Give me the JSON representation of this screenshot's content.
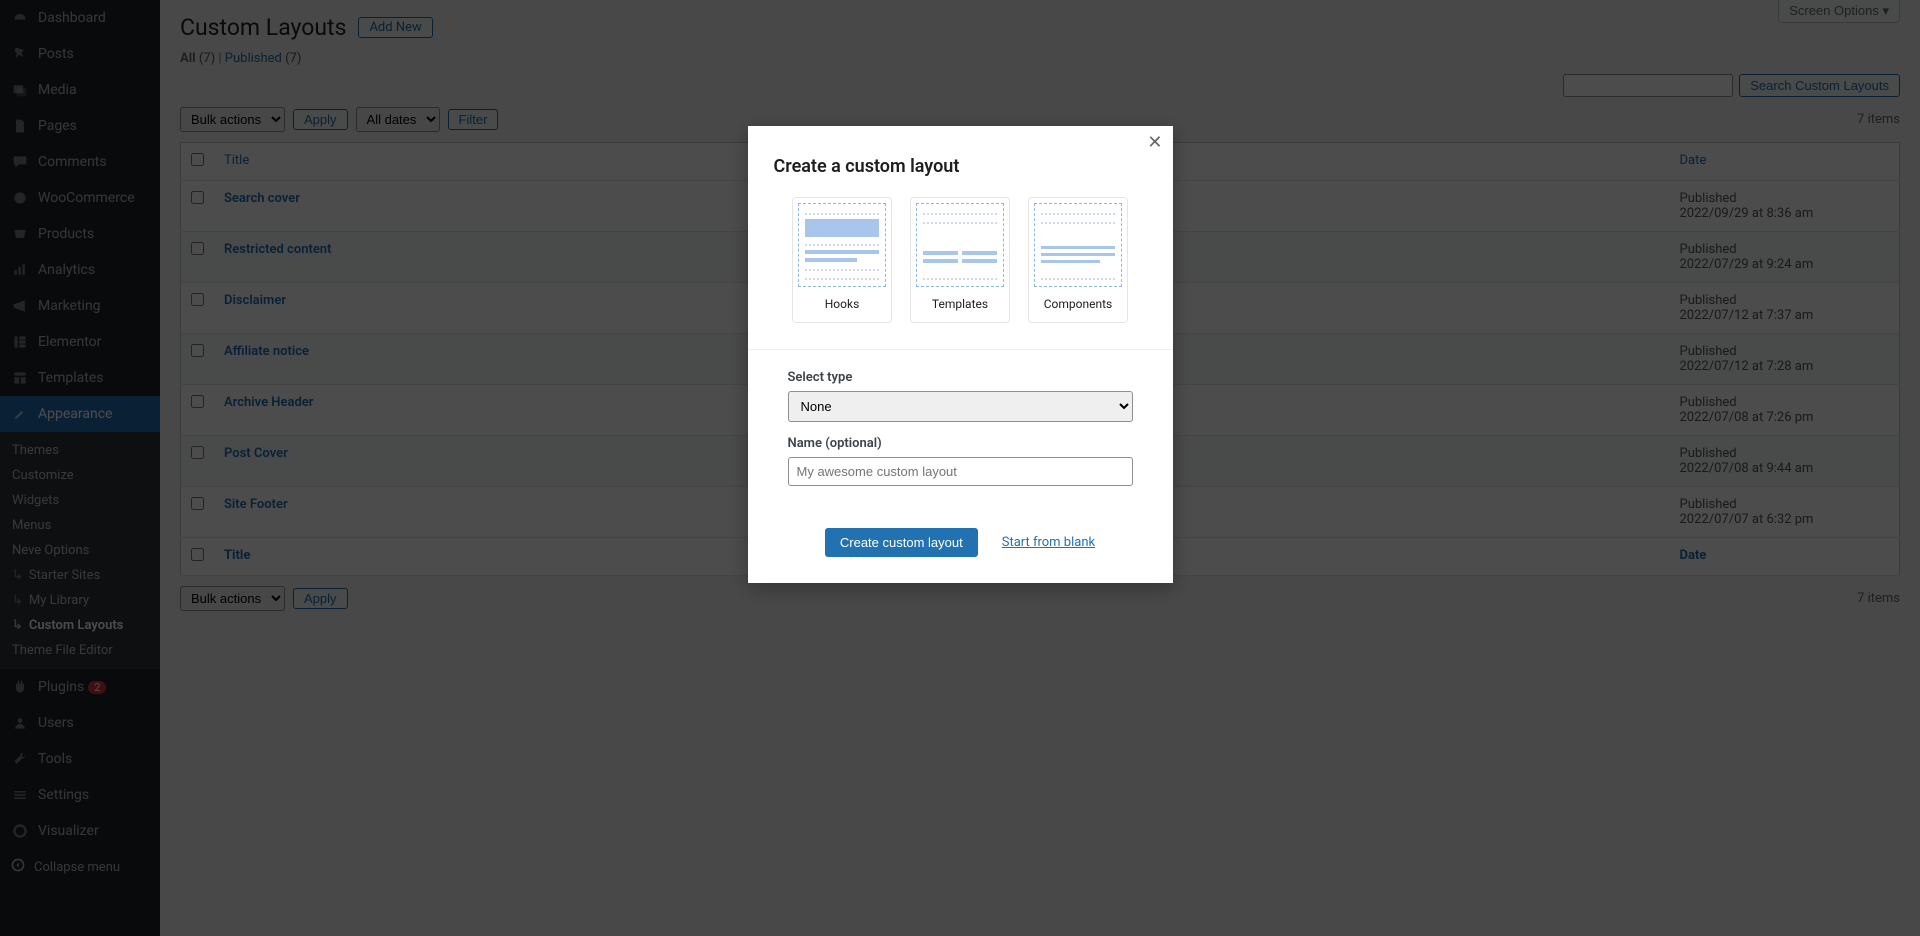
{
  "screen_options": "Screen Options ▾",
  "page_title": "Custom Layouts",
  "add_new": "Add New",
  "filters": {
    "all_label": "All",
    "all_count": "(7)",
    "sep": " | ",
    "published_label": "Published",
    "published_count": "(7)"
  },
  "search": {
    "button": "Search Custom Layouts"
  },
  "bulk_actions": "Bulk actions",
  "apply": "Apply",
  "all_dates": "All dates",
  "filter": "Filter",
  "item_count": "7 items",
  "columns": {
    "title": "Title",
    "date": "Date"
  },
  "rows": [
    {
      "title": "Search cover",
      "status": "Published",
      "datetime": "2022/09/29 at 8:36 am"
    },
    {
      "title": "Restricted content",
      "status": "Published",
      "datetime": "2022/07/29 at 9:24 am"
    },
    {
      "title": "Disclaimer",
      "status": "Published",
      "datetime": "2022/07/12 at 7:37 am"
    },
    {
      "title": "Affiliate notice",
      "status": "Published",
      "datetime": "2022/07/12 at 7:28 am"
    },
    {
      "title": "Archive Header",
      "status": "Published",
      "datetime": "2022/07/08 at 7:26 pm"
    },
    {
      "title": "Post Cover",
      "status": "Published",
      "datetime": "2022/07/08 at 9:44 am"
    },
    {
      "title": "Site Footer",
      "status": "Published",
      "datetime": "2022/07/07 at 6:32 pm"
    }
  ],
  "sidebar": {
    "items": [
      "Dashboard",
      "Posts",
      "Media",
      "Pages",
      "Comments",
      "WooCommerce",
      "Products",
      "Analytics",
      "Marketing",
      "Elementor",
      "Templates",
      "Appearance",
      "Plugins",
      "Users",
      "Tools",
      "Settings",
      "Visualizer"
    ],
    "plugins_badge": "2",
    "appearance_submenu": [
      "Themes",
      "Customize",
      "Widgets",
      "Menus",
      "Neve Options",
      "Starter Sites",
      "My Library",
      "Custom Layouts",
      "Theme File Editor"
    ],
    "collapse": "Collapse menu"
  },
  "modal": {
    "title": "Create a custom layout",
    "types": [
      "Hooks",
      "Templates",
      "Components"
    ],
    "select_type_label": "Select type",
    "select_type_value": "None",
    "name_label": "Name (optional)",
    "name_placeholder": "My awesome custom layout",
    "create_btn": "Create custom layout",
    "blank_link": "Start from blank"
  }
}
